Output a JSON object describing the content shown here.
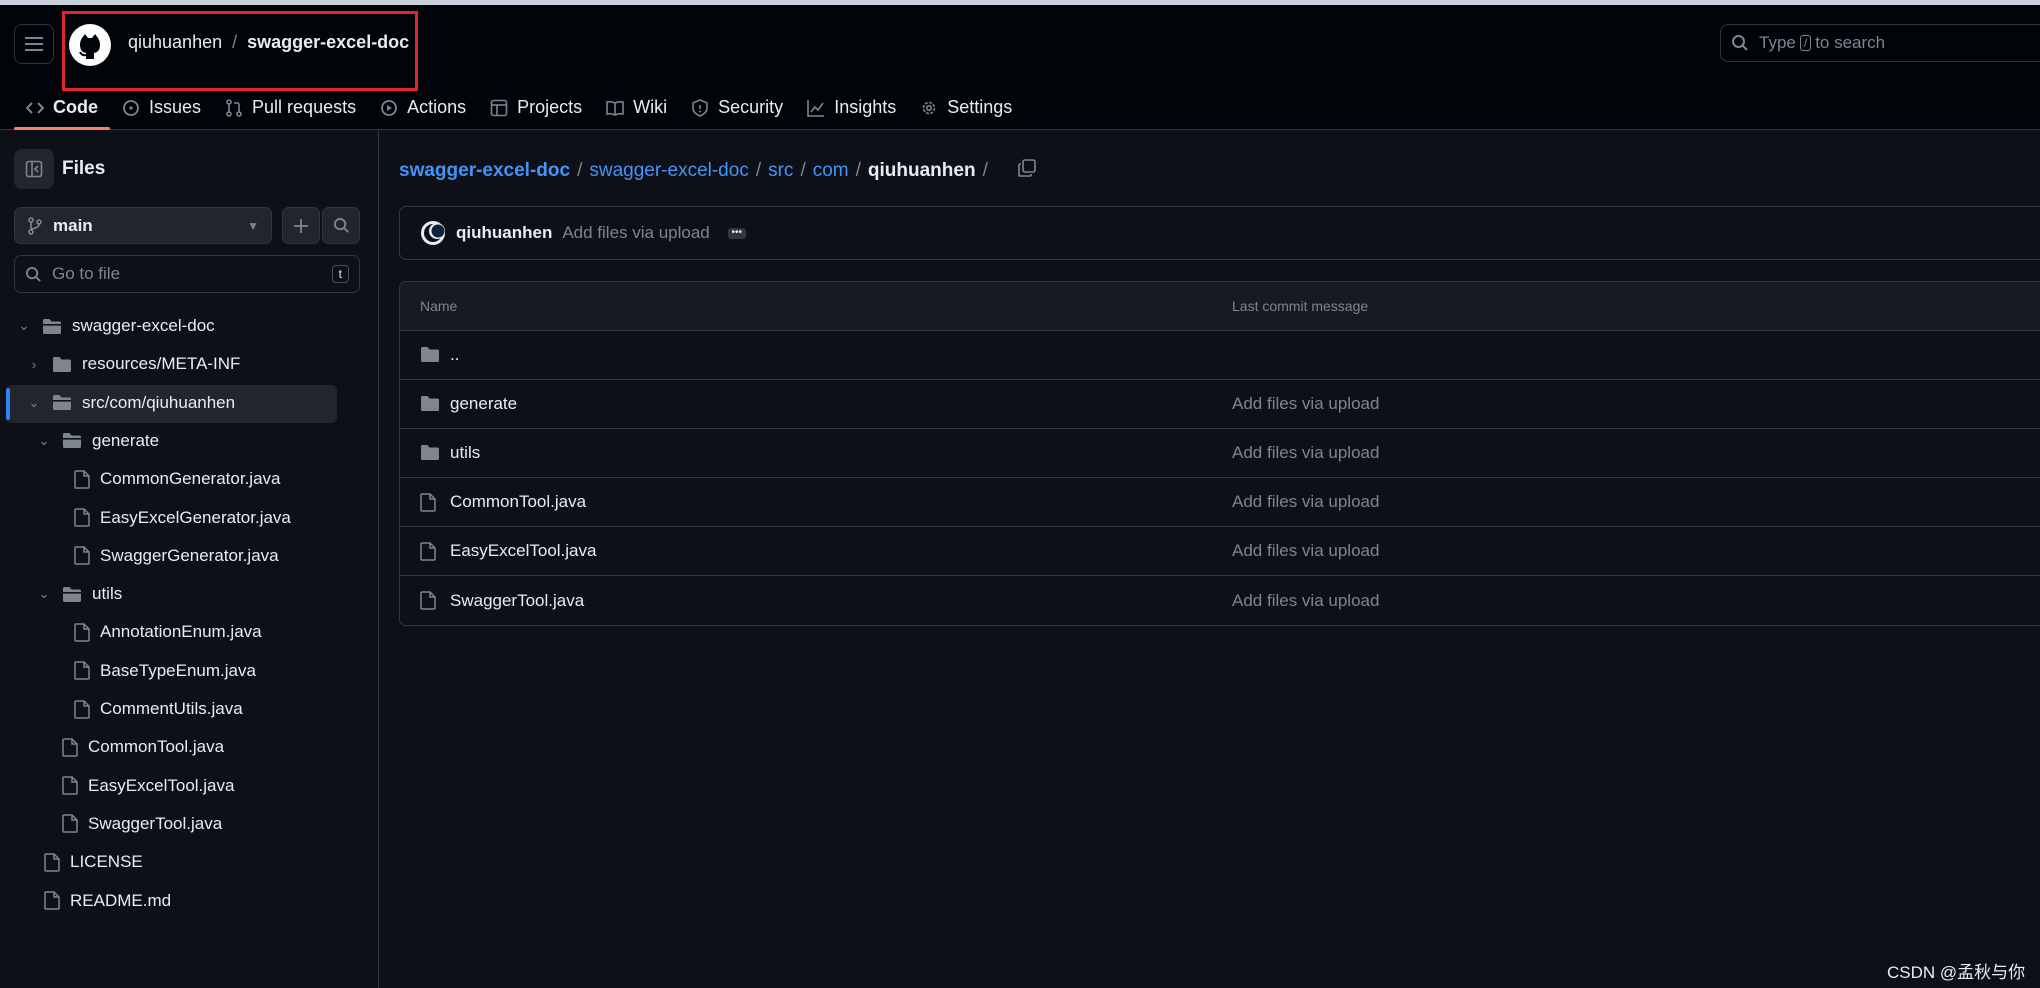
{
  "header": {
    "owner": "qiuhuanhen",
    "separator": "/",
    "repo": "swagger-excel-doc",
    "search_prefix": "Type",
    "search_key": "/",
    "search_suffix": "to search"
  },
  "tabs": [
    {
      "label": "Code",
      "icon": "code-icon",
      "active": true
    },
    {
      "label": "Issues",
      "icon": "issue-icon"
    },
    {
      "label": "Pull requests",
      "icon": "pull-request-icon"
    },
    {
      "label": "Actions",
      "icon": "play-icon"
    },
    {
      "label": "Projects",
      "icon": "table-icon"
    },
    {
      "label": "Wiki",
      "icon": "book-icon"
    },
    {
      "label": "Security",
      "icon": "shield-icon"
    },
    {
      "label": "Insights",
      "icon": "graph-icon"
    },
    {
      "label": "Settings",
      "icon": "gear-icon"
    }
  ],
  "sidebar": {
    "title": "Files",
    "branch": "main",
    "goto_placeholder": "Go to file",
    "goto_key": "t",
    "tree": [
      {
        "label": "swagger-excel-doc",
        "type": "folder",
        "depth": 0,
        "expanded": true
      },
      {
        "label": "resources/META-INF",
        "type": "folder",
        "depth": 1,
        "expanded": false
      },
      {
        "label": "src/com/qiuhuanhen",
        "type": "folder",
        "depth": 1,
        "expanded": true,
        "selected": true
      },
      {
        "label": "generate",
        "type": "folder",
        "depth": 2,
        "expanded": true
      },
      {
        "label": "CommonGenerator.java",
        "type": "file",
        "depth": 3
      },
      {
        "label": "EasyExcelGenerator.java",
        "type": "file",
        "depth": 3
      },
      {
        "label": "SwaggerGenerator.java",
        "type": "file",
        "depth": 3
      },
      {
        "label": "utils",
        "type": "folder",
        "depth": 2,
        "expanded": true
      },
      {
        "label": "AnnotationEnum.java",
        "type": "file",
        "depth": 3
      },
      {
        "label": "BaseTypeEnum.java",
        "type": "file",
        "depth": 3
      },
      {
        "label": "CommentUtils.java",
        "type": "file",
        "depth": 3
      },
      {
        "label": "CommonTool.java",
        "type": "file",
        "depth": 2
      },
      {
        "label": "EasyExcelTool.java",
        "type": "file",
        "depth": 2
      },
      {
        "label": "SwaggerTool.java",
        "type": "file",
        "depth": 2
      },
      {
        "label": "LICENSE",
        "type": "file",
        "depth": 1
      },
      {
        "label": "README.md",
        "type": "file",
        "depth": 1
      }
    ]
  },
  "breadcrumb": {
    "parts": [
      "swagger-excel-doc",
      "swagger-excel-doc",
      "src",
      "com"
    ],
    "current": "qiuhuanhen",
    "trailing": "/"
  },
  "commit": {
    "author": "qiuhuanhen",
    "message": "Add files via upload"
  },
  "table": {
    "col_name": "Name",
    "col_message": "Last commit message",
    "rows": [
      {
        "name": "..",
        "type": "folder",
        "message": ""
      },
      {
        "name": "generate",
        "type": "folder",
        "message": "Add files via upload"
      },
      {
        "name": "utils",
        "type": "folder",
        "message": "Add files via upload"
      },
      {
        "name": "CommonTool.java",
        "type": "file",
        "message": "Add files via upload"
      },
      {
        "name": "EasyExcelTool.java",
        "type": "file",
        "message": "Add files via upload"
      },
      {
        "name": "SwaggerTool.java",
        "type": "file",
        "message": "Add files via upload"
      }
    ]
  },
  "watermark": "CSDN @孟秋与你",
  "colors": {
    "bg": "#0d1117",
    "header_bg": "#010409",
    "link": "#4493f8",
    "muted": "#7d8590",
    "tab_underline": "#f78166",
    "highlight": "#e0262a"
  }
}
